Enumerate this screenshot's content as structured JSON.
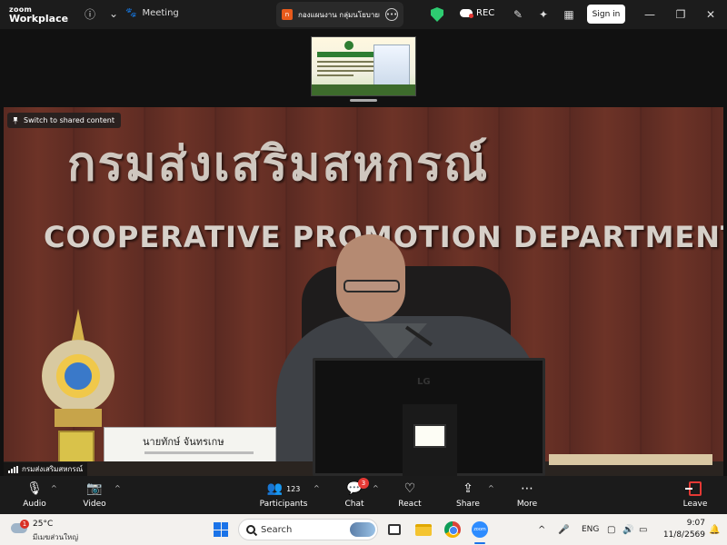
{
  "app": {
    "brand_line1": "zoom",
    "brand_line2": "Workplace",
    "info_icon": "info-icon",
    "meeting_label": "Meeting",
    "tab_title": "กองแผนงาน กลุ่มนโยบายและ",
    "rec_label": "REC",
    "signin_label": "Sign in"
  },
  "shared": {
    "switch_label": "Switch to shared content"
  },
  "video": {
    "sign_thai": "กรมส่งเสริมสหกรณ์",
    "sign_english": "COOPERATIVE PROMOTION DEPARTMENT",
    "nameplate": "นายทักษ์ จันทรเกษ",
    "monitor_brand": "LG",
    "participant_name": "กรมส่งเสริมสหกรณ์"
  },
  "toolbar": {
    "audio": "Audio",
    "video": "Video",
    "participants": "Participants",
    "participants_count": "123",
    "chat": "Chat",
    "chat_badge": "3",
    "react": "React",
    "share": "Share",
    "more": "More",
    "leave": "Leave"
  },
  "taskbar": {
    "weather_temp": "25°C",
    "weather_desc": "มีเมฆส่วนใหญ่",
    "weather_badge": "1",
    "search_placeholder": "Search",
    "lang": "ENG",
    "time": "9:07",
    "date": "11/8/2569"
  },
  "colors": {
    "accent_red": "#e53935",
    "zoom_blue": "#2d8cff",
    "shield_green": "#2ecc71"
  }
}
